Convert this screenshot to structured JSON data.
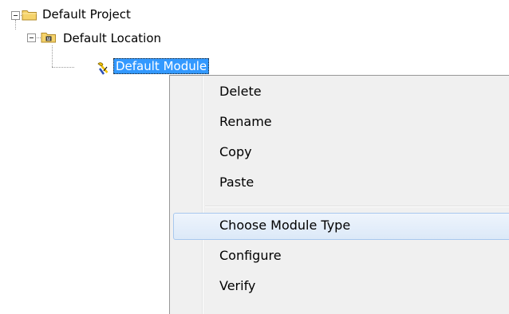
{
  "tree": {
    "nodes": [
      {
        "label": "Default Project",
        "icon": "folder-icon",
        "expanded": true
      },
      {
        "label": "Default Location",
        "icon": "folder-location-icon",
        "expanded": true
      },
      {
        "label": "Default Module",
        "icon": "module-tool-icon",
        "selected": true
      }
    ]
  },
  "context_menu": {
    "items": [
      {
        "label": "Delete"
      },
      {
        "label": "Rename"
      },
      {
        "label": "Copy"
      },
      {
        "label": "Paste"
      },
      {
        "label": "Choose Module Type",
        "highlighted": true
      },
      {
        "label": "Configure"
      },
      {
        "label": "Verify"
      }
    ]
  },
  "colors": {
    "selection": "#3399ff",
    "menu_background": "#f0f0f0",
    "highlight_border": "#a8c8ee",
    "folder_yellow": "#f5d36b"
  }
}
